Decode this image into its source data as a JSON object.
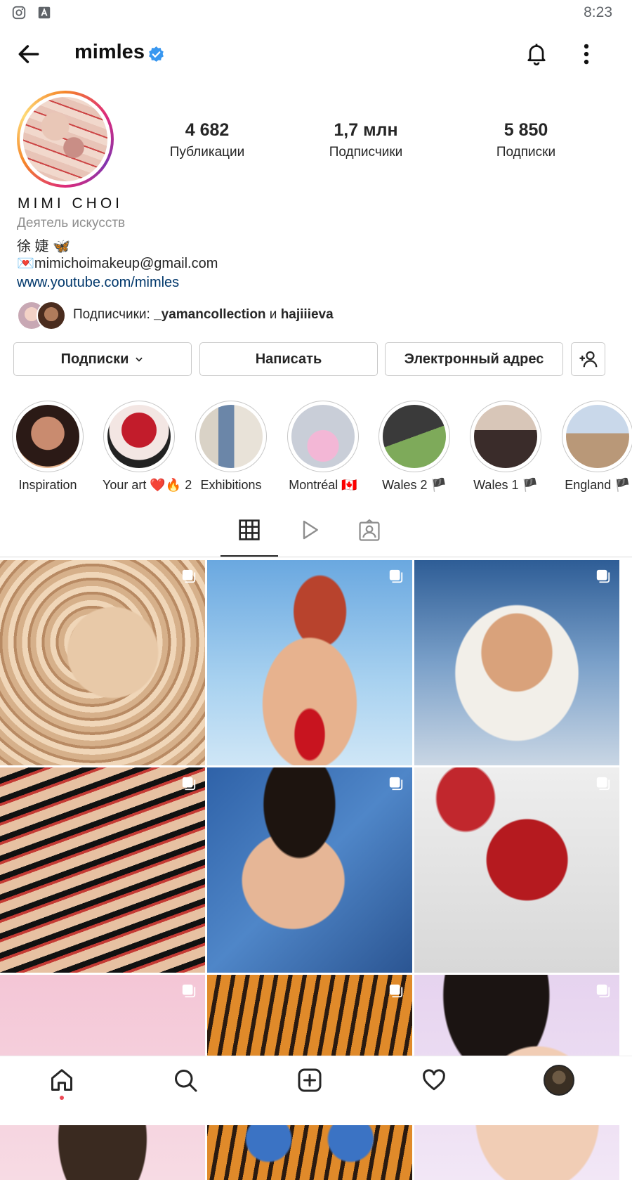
{
  "status_bar": {
    "time": "8:23"
  },
  "header": {
    "username": "mimles"
  },
  "profile": {
    "stats": [
      {
        "value": "4 682",
        "label": "Публикации"
      },
      {
        "value": "1,7 млн",
        "label": "Подписчики"
      },
      {
        "value": "5 850",
        "label": "Подписки"
      }
    ],
    "full_name": "MIMI CHOI",
    "category": "Деятель искусств",
    "bio_line1": "徐 婕 🦋",
    "bio_line2": "💌mimichoimakeup@gmail.com",
    "link": "www.youtube.com/mimles",
    "followed_by": {
      "prefix": "Подписчики: ",
      "user1": "_yamancollection",
      "conjunction": " и ",
      "user2": "hajiiieva"
    }
  },
  "buttons": {
    "following": "Подписки",
    "message": "Написать",
    "email": "Электронный адрес"
  },
  "highlights": [
    {
      "label": "Inspiration"
    },
    {
      "label": "Your art ❤️🔥 2"
    },
    {
      "label": "Exhibitions"
    },
    {
      "label": "Montréal 🇨🇦"
    },
    {
      "label": "Wales 2 🏴"
    },
    {
      "label": "Wales 1 🏴"
    },
    {
      "label": "England 🏴"
    }
  ],
  "tabs": [
    "grid-icon",
    "reels-icon",
    "tagged-icon"
  ],
  "colors": {
    "link": "#00376b",
    "verified": "#3897f0",
    "notification_dot": "#ed4956"
  }
}
